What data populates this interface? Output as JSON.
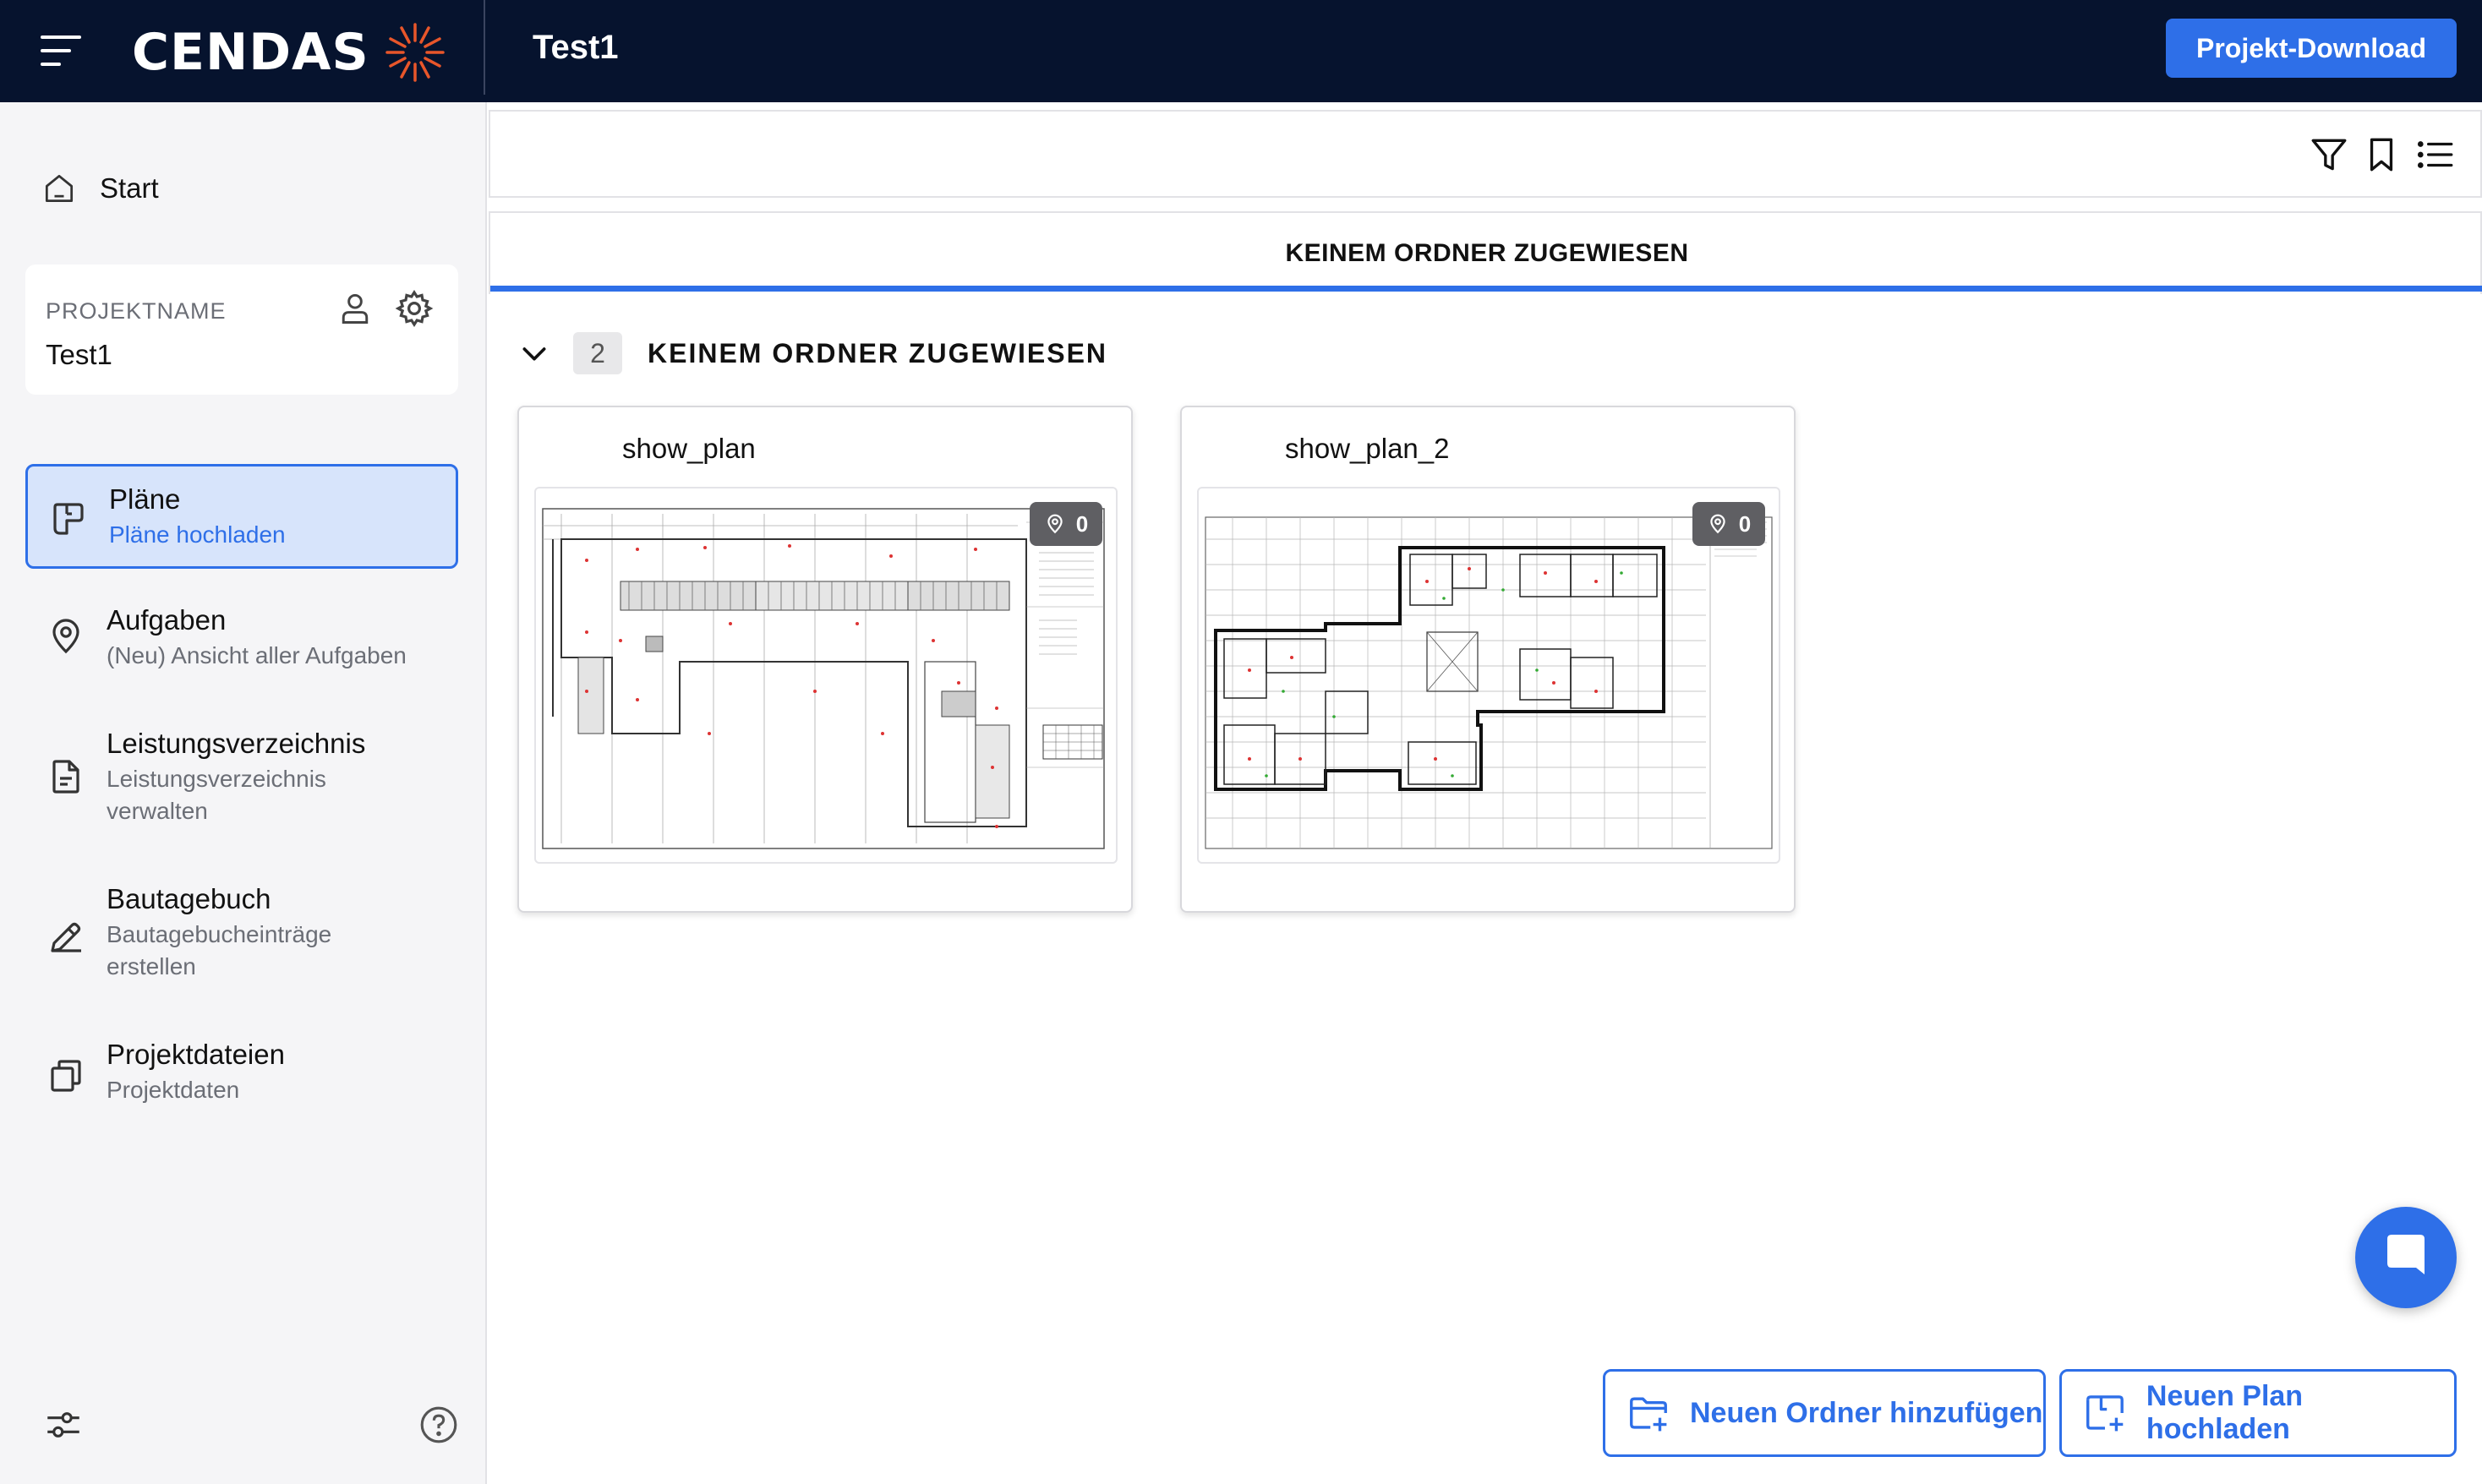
{
  "app": {
    "brand": "CENDAS",
    "project_title": "Test1",
    "download_label": "Projekt-Download"
  },
  "sidebar": {
    "start_label": "Start",
    "project": {
      "label": "PROJEKTNAME",
      "value": "Test1"
    },
    "items": [
      {
        "title": "Pläne",
        "sub": "Pläne hochladen",
        "icon": "plan-icon",
        "active": true
      },
      {
        "title": "Aufgaben",
        "sub": "(Neu) Ansicht aller Aufgaben",
        "icon": "location-pin-icon"
      },
      {
        "title": "Leistungsverzeichnis",
        "sub": "Leistungsverzeichnis verwalten",
        "icon": "document-icon"
      },
      {
        "title": "Bautagebuch",
        "sub": "Bautagebucheinträge erstellen",
        "icon": "pencil-icon"
      },
      {
        "title": "Projektdateien",
        "sub": "Projektdaten",
        "icon": "files-icon"
      }
    ]
  },
  "main": {
    "tab_label": "KEINEM ORDNER ZUGEWIESEN",
    "group": {
      "count": "2",
      "title": "KEINEM ORDNER ZUGEWIESEN"
    },
    "plans": [
      {
        "name": "show_plan",
        "pins": "0"
      },
      {
        "name": "show_plan_2",
        "pins": "0"
      }
    ],
    "add_folder_label": "Neuen Ordner hinzufügen",
    "upload_plan_label": "Neuen Plan hochladen"
  },
  "colors": {
    "topbar": "#06132e",
    "accent": "#2e6fe8",
    "brand_orange": "#e8562a"
  }
}
